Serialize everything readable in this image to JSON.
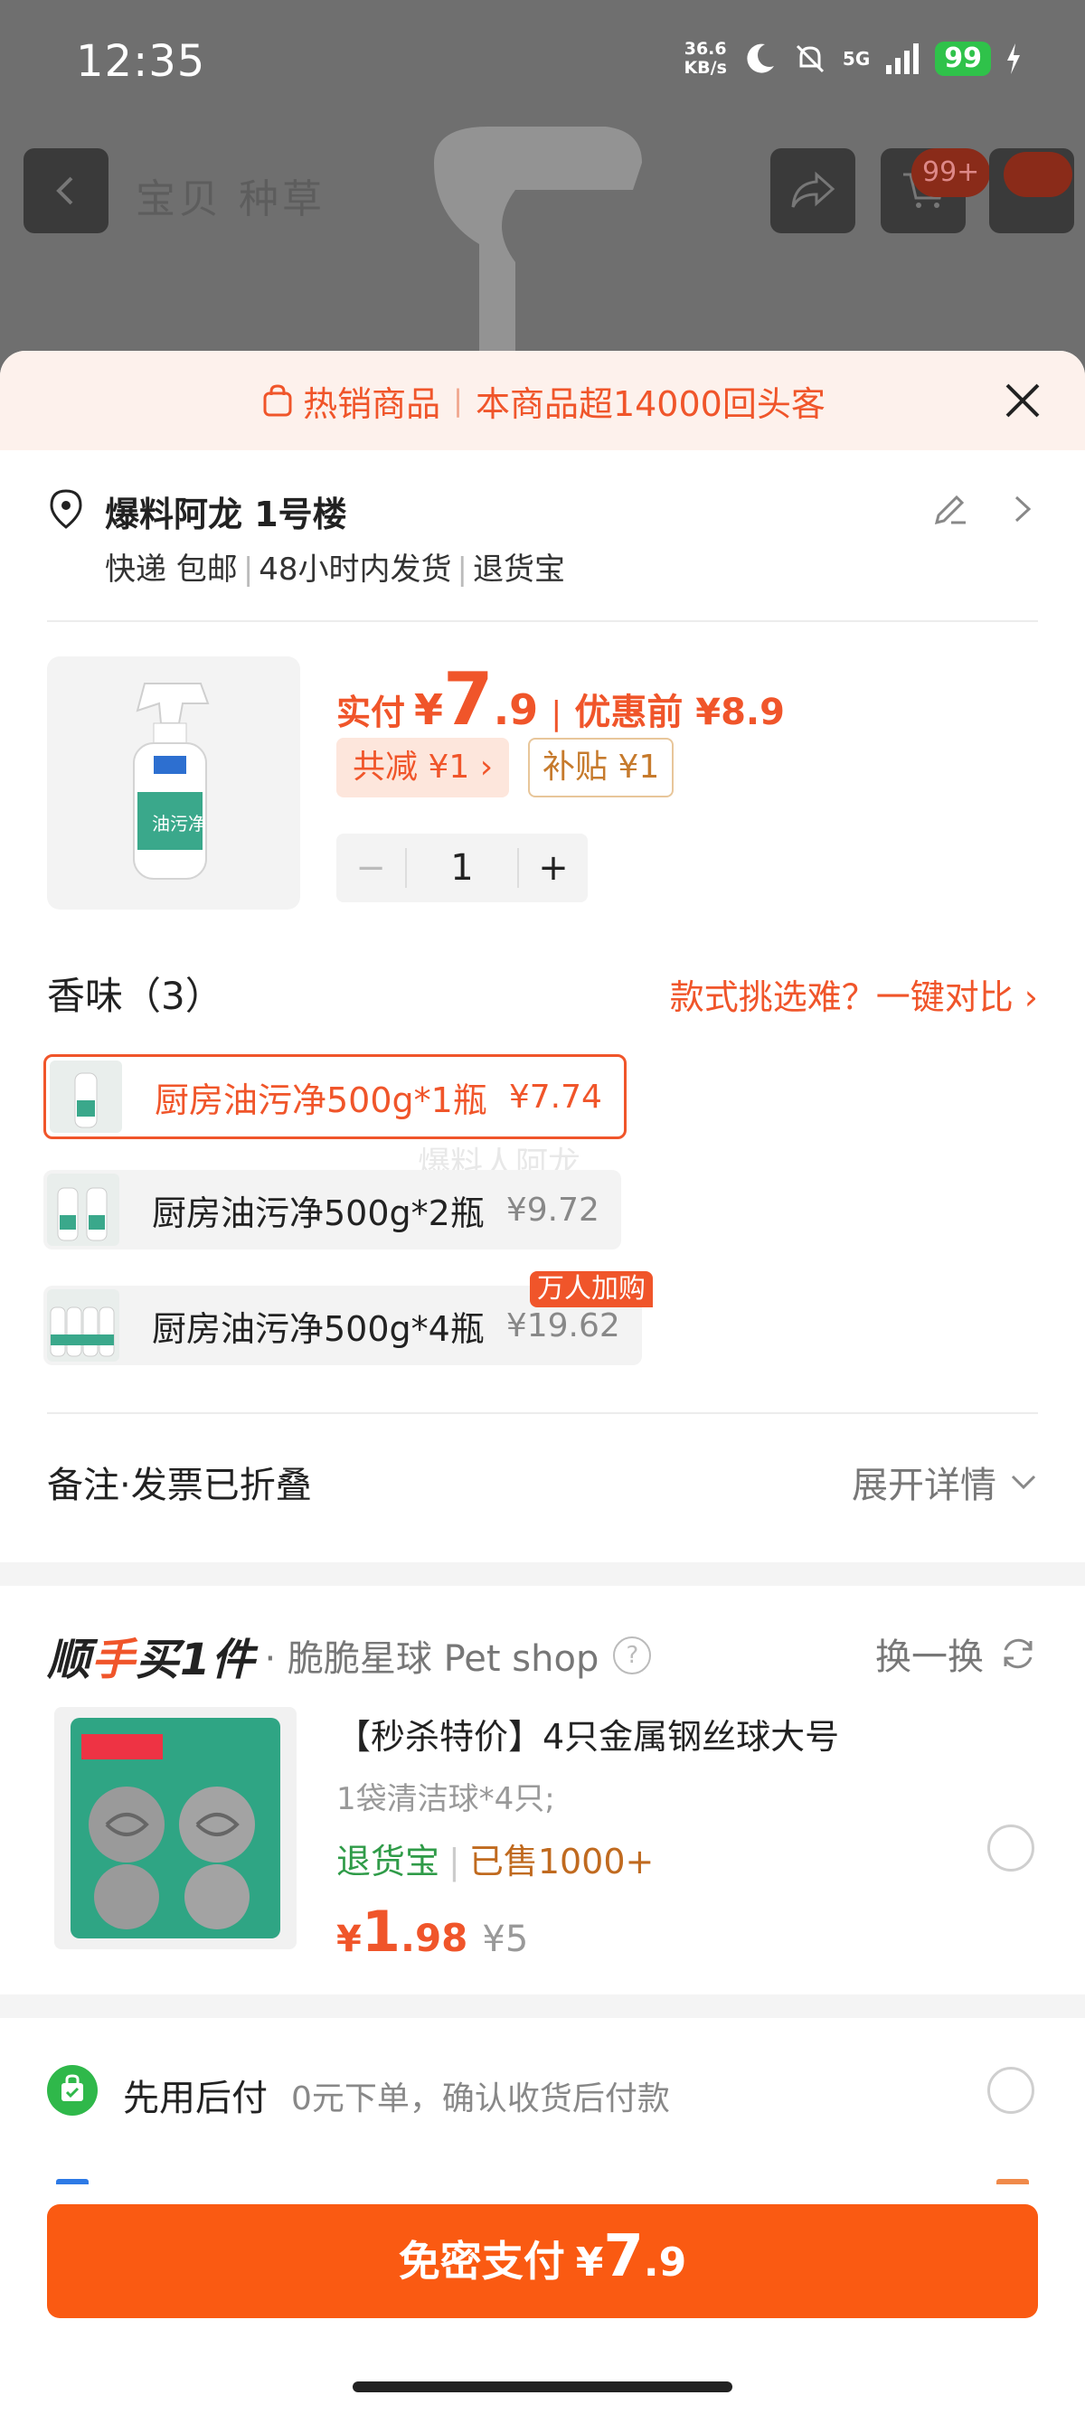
{
  "status_bar": {
    "time": "12:35",
    "net_speed_value": "36.6",
    "net_speed_unit": "KB/s",
    "network": "5G",
    "battery": "99"
  },
  "top_nav": {
    "title": "宝贝 种草",
    "cart_badge": "99+"
  },
  "banner": {
    "hot_label": "热销商品",
    "repeat_text": "本商品超14000回头客"
  },
  "address": {
    "name": "爆料阿龙 1号楼",
    "shipping": "快递 包邮",
    "ship_time": "48小时内发货",
    "return": "退货宝"
  },
  "product": {
    "pay_label": "实付",
    "currency": "¥",
    "price_int": "7",
    "price_dec": ".9",
    "orig_price": "优惠前 ¥8.9",
    "reduce_tag": "共减 ¥1 ›",
    "subsidy_tag": "补贴 ¥1",
    "qty_minus": "−",
    "qty": "1",
    "qty_plus": "+"
  },
  "flavor": {
    "title": "香味（3）",
    "compare_link": "款式挑选难？一键对比",
    "variants": [
      {
        "name": "厨房油污净500g*1瓶",
        "price": "¥7.74"
      },
      {
        "name": "厨房油污净500g*2瓶",
        "price": "¥9.72"
      },
      {
        "name": "厨房油污净500g*4瓶",
        "price": "¥19.62"
      }
    ],
    "hot_badge": "万人加购",
    "watermark": "爆料人阿龙"
  },
  "remark": {
    "label": "备注·发票已折叠",
    "expand": "展开详情"
  },
  "addon": {
    "logo_a": "顺",
    "logo_b": "手",
    "logo_c": "买1件",
    "shop": "· 脆脆星球 Pet shop",
    "help": "?",
    "swap": "换一换",
    "title": "【秒杀特价】4只金属钢丝球大号",
    "spec": "1袋清洁球*4只;",
    "tag_return": "退货宝",
    "sold": "已售1000+",
    "currency": "¥",
    "price_int": "1",
    "price_dec": ".98",
    "orig_price": "¥5"
  },
  "paylater": {
    "label": "先用后付",
    "desc": "0元下单，确认收货后付款"
  },
  "pay_button": {
    "label": "免密支付",
    "currency": "¥",
    "price_int": "7",
    "price_dec": ".9"
  },
  "colors": {
    "accent": "#f0552a",
    "pay_button": "#fa5a12",
    "green": "#2f9b48"
  }
}
